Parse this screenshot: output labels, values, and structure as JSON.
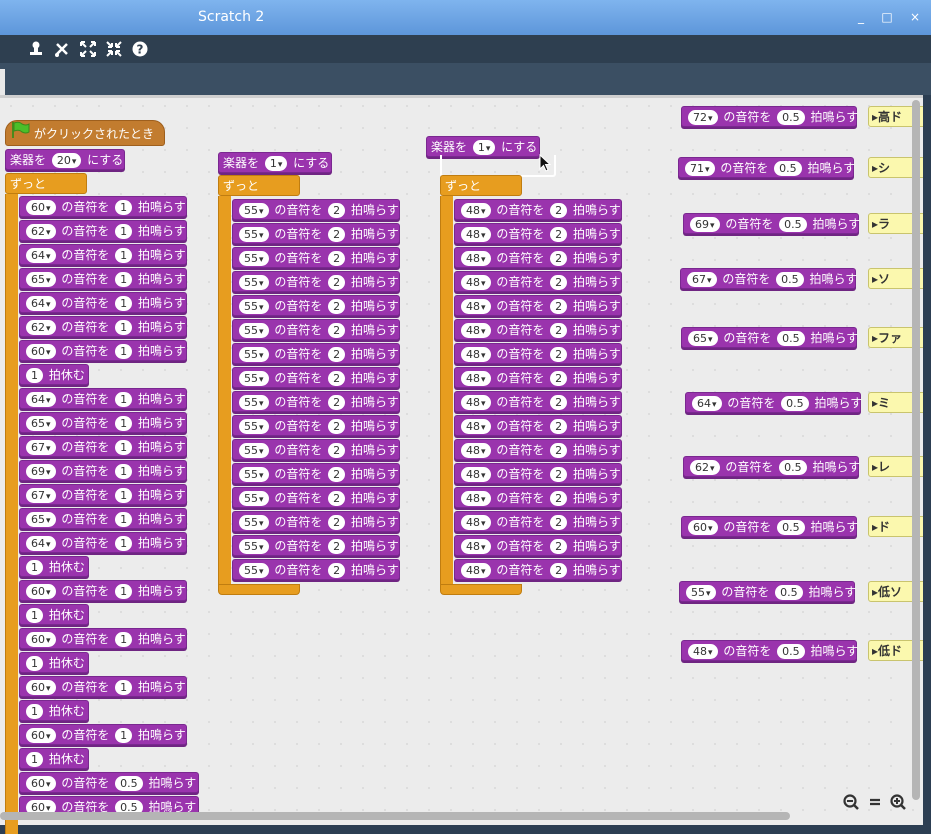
{
  "window": {
    "title": "Scratch 2",
    "controls": [
      "_",
      "□",
      "×"
    ]
  },
  "toolbar": {
    "icons": [
      "duplicate-icon",
      "cut-icon",
      "grow-icon",
      "shrink-icon",
      "help-icon"
    ]
  },
  "labels": {
    "flag_hat": "がクリックされたとき",
    "set_instrument_pre": "楽器を",
    "set_instrument_post": "にする",
    "forever": "ずっと",
    "play_mid": "の音符を",
    "play_post": "拍鳴らす",
    "rest_post": "拍休む"
  },
  "script1": {
    "instrument": "20",
    "steps": [
      [
        "n",
        "60",
        "1"
      ],
      [
        "n",
        "62",
        "1"
      ],
      [
        "n",
        "64",
        "1"
      ],
      [
        "n",
        "65",
        "1"
      ],
      [
        "n",
        "64",
        "1"
      ],
      [
        "n",
        "62",
        "1"
      ],
      [
        "n",
        "60",
        "1"
      ],
      [
        "r",
        "1"
      ],
      [
        "n",
        "64",
        "1"
      ],
      [
        "n",
        "65",
        "1"
      ],
      [
        "n",
        "67",
        "1"
      ],
      [
        "n",
        "69",
        "1"
      ],
      [
        "n",
        "67",
        "1"
      ],
      [
        "n",
        "65",
        "1"
      ],
      [
        "n",
        "64",
        "1"
      ],
      [
        "r",
        "1"
      ],
      [
        "n",
        "60",
        "1"
      ],
      [
        "r",
        "1"
      ],
      [
        "n",
        "60",
        "1"
      ],
      [
        "r",
        "1"
      ],
      [
        "n",
        "60",
        "1"
      ],
      [
        "r",
        "1"
      ],
      [
        "n",
        "60",
        "1"
      ],
      [
        "r",
        "1"
      ],
      [
        "n",
        "60",
        "0.5"
      ],
      [
        "n",
        "60",
        "0.5"
      ]
    ]
  },
  "script2": {
    "instrument": "1",
    "note": "55",
    "beats": "2",
    "count": 16
  },
  "script3": {
    "instrument": "1",
    "note": "48",
    "beats": "2",
    "count": 16
  },
  "side": [
    {
      "note": "72",
      "beats": "0.5",
      "label": "高ド"
    },
    {
      "note": "71",
      "beats": "0.5",
      "label": "シ"
    },
    {
      "note": "69",
      "beats": "0.5",
      "label": "ラ"
    },
    {
      "note": "67",
      "beats": "0.5",
      "label": "ソ"
    },
    {
      "note": "65",
      "beats": "0.5",
      "label": "ファ"
    },
    {
      "note": "64",
      "beats": "0.5",
      "label": "ミ"
    },
    {
      "note": "62",
      "beats": "0.5",
      "label": "レ"
    },
    {
      "note": "60",
      "beats": "0.5",
      "label": "ド"
    },
    {
      "note": "55",
      "beats": "0.5",
      "label": "低ソ"
    },
    {
      "note": "48",
      "beats": "0.5",
      "label": "低ド"
    }
  ],
  "zoom": {
    "out": "−",
    "reset": "=",
    "in": "+"
  }
}
